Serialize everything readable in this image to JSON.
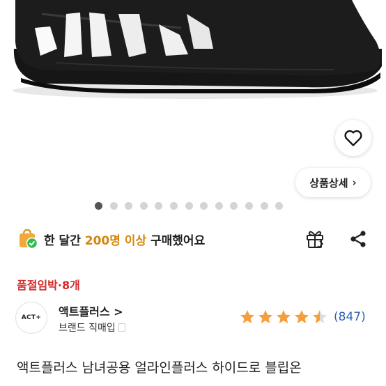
{
  "product": {
    "title": "액트플러스 남녀공용 얼라인플러스 하이드로 블립온",
    "detail_button": "상품상세",
    "stock_alert": "품절임박·8개"
  },
  "carousel": {
    "total": 13,
    "active_index": 0
  },
  "sales": {
    "prefix": "한 달간 ",
    "highlight": "200명 이상",
    "suffix": " 구매했어요",
    "highlight_color": "#d4860a"
  },
  "brand": {
    "logo_text": "ACT+",
    "name": "액트플러스 >",
    "sub": "브랜드 직매입"
  },
  "rating": {
    "value": 4.5,
    "max": 5,
    "count": "(847)",
    "star_color": "#f59e3b"
  },
  "icons": {
    "wishlist": "heart-icon",
    "gift": "gift-icon",
    "share": "share-icon",
    "sales_badge": "shopping-bag-check-icon"
  }
}
